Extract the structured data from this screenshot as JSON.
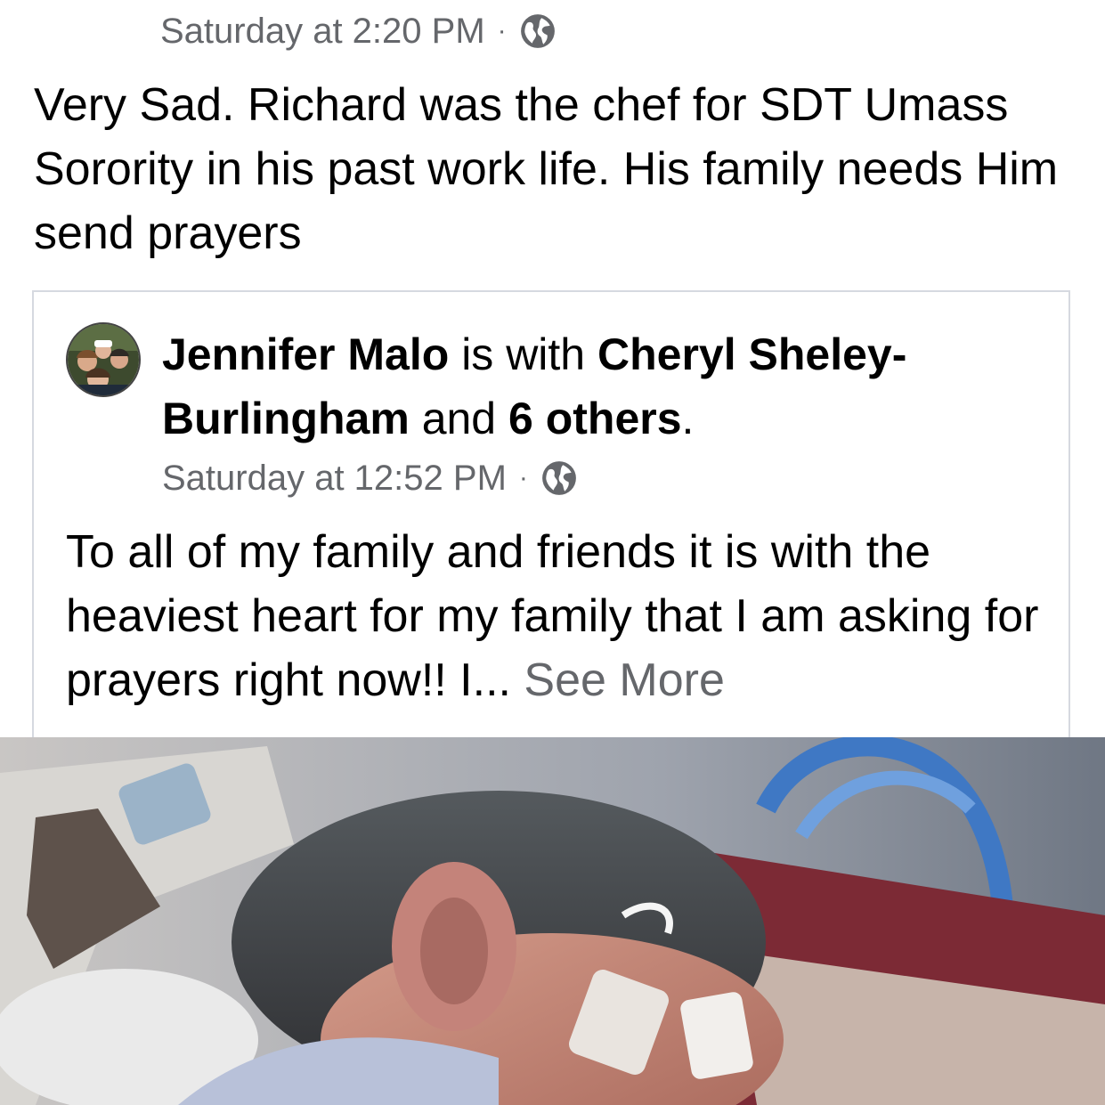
{
  "post": {
    "timestamp": "Saturday at 2:20 PM",
    "separator": "·",
    "privacy_icon": "globe-icon",
    "text": "Very Sad. Richard was the chef for SDT Umass Sorority in his past work life. His family needs Him send prayers"
  },
  "shared_post": {
    "author": "Jennifer Malo",
    "with_text": " is with ",
    "tagged": "Cheryl Sheley-Burlingham",
    "and_text": " and ",
    "others": "6 others",
    "period": ".",
    "timestamp": "Saturday at 12:52 PM",
    "separator": "·",
    "privacy_icon": "globe-icon",
    "text": "To all of my family and friends it is with the heaviest heart for my family that I am asking for prayers right now!! I... ",
    "see_more": "See More"
  },
  "photo": {
    "subject": "hospital-patient-photo"
  }
}
